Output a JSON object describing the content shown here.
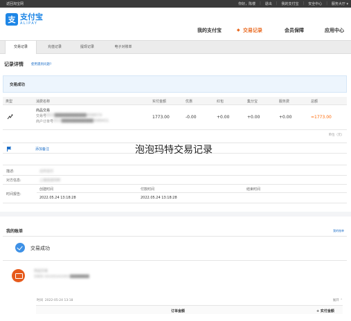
{
  "topbar": {
    "back": "返回淘宝网",
    "greeting": "你好，陈楼",
    "links": [
      "退出",
      "我的支付宝",
      "安全中心",
      "服务大厅 ▾"
    ]
  },
  "logo": {
    "cn": "支付宝",
    "en": "ALIPAY",
    "mark": "支"
  },
  "mainnav": {
    "items": [
      "我的支付宝",
      "交易记录",
      "会员保障",
      "应用中心"
    ],
    "active_index": 1
  },
  "subnav": {
    "tabs": [
      "交易记录",
      "充值记录",
      "提现记录",
      "电子对账单"
    ],
    "active_index": 0
  },
  "record": {
    "heading": "记录详情",
    "help_link": "使用遇到问题?",
    "status_bar": "交易成功",
    "columns": [
      "类型",
      "消费名称",
      "实付金额",
      "优惠",
      "红包",
      "集分宝",
      "服务费",
      "总额"
    ],
    "row": {
      "name": "商品交易",
      "order_no_label": "交易号",
      "order_no_value": "2022████████████4568574",
      "merchant_order_label": "商户订单号",
      "merchant_order_value": "2022████████████3089431",
      "paid": "1773.00",
      "discount": "-0.00",
      "red_packet": "+0.00",
      "points": "+0.00",
      "service_fee": "+0.00",
      "total": "=1773.00"
    },
    "unit": "单位（元）",
    "add_note": "添加备注",
    "watermark": "泡泡玛特交易记录"
  },
  "info": {
    "desc_label": "描述:",
    "desc_value": "合并支付",
    "party_label": "对方信息:",
    "party_value": "上海泡泡玛特",
    "time_label": "时间报告:",
    "created_header": "创建时间",
    "paid_header": "付款时间",
    "finished_header": "结束时间",
    "created_value": "2022.05.24 13:18:28",
    "paid_value": "2022.05.24 13:18:28",
    "finished_value": ""
  },
  "account": {
    "title": "我的账单",
    "link": "我的账单",
    "status": "交易成功",
    "item_name": "商品交易",
    "item_sub": "交易号 2022052422001████████",
    "time_label": "时间",
    "time_value": "2022-05-24 13:18",
    "detail_link": "展开",
    "col_order_amount": "订单金额",
    "col_paid": "+ 实付金额"
  }
}
